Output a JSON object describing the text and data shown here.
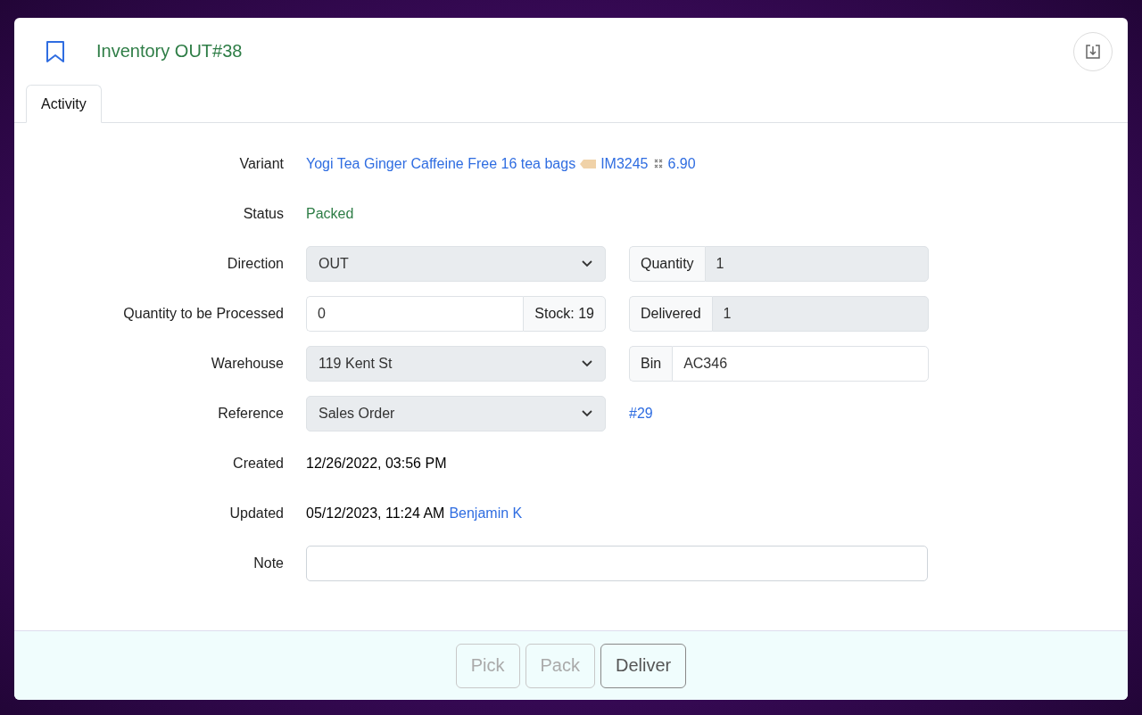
{
  "header": {
    "title": "Inventory OUT#38"
  },
  "tabs": [
    {
      "label": "Activity",
      "selected": true
    }
  ],
  "rows": [
    {
      "kind": "variant",
      "label": "Variant",
      "name": "Yogi Tea Ginger Caffeine Free 16 tea bags",
      "sku": "IM3245",
      "price": "6.90"
    },
    {
      "kind": "status",
      "label": "Status",
      "value": "Packed"
    },
    {
      "kind": "select-pair",
      "label": "Direction",
      "value": "OUT",
      "side_label": "Quantity",
      "side_value": "1",
      "side_disabled": true
    },
    {
      "kind": "input-pair",
      "label": "Quantity to be Processed",
      "value": "0",
      "addon": "Stock: 19",
      "side_label": "Delivered",
      "side_value": "1",
      "side_disabled": true
    },
    {
      "kind": "select-pair",
      "label": "Warehouse",
      "value": "119 Kent St",
      "side_label": "Bin",
      "side_value": "AC346",
      "side_disabled": false
    },
    {
      "kind": "select-link",
      "label": "Reference",
      "value": "Sales Order",
      "link": "#29"
    },
    {
      "kind": "text",
      "label": "Created",
      "value": "12/26/2022, 03:56 PM"
    },
    {
      "kind": "text",
      "label": "Updated",
      "value": "05/12/2023, 11:24 AM",
      "link": "Benjamin K"
    },
    {
      "kind": "textarea",
      "label": "Note"
    }
  ],
  "actions": [
    {
      "label": "Pick",
      "disabled": true
    },
    {
      "label": "Pack",
      "disabled": true
    },
    {
      "label": "Deliver",
      "disabled": false
    }
  ]
}
